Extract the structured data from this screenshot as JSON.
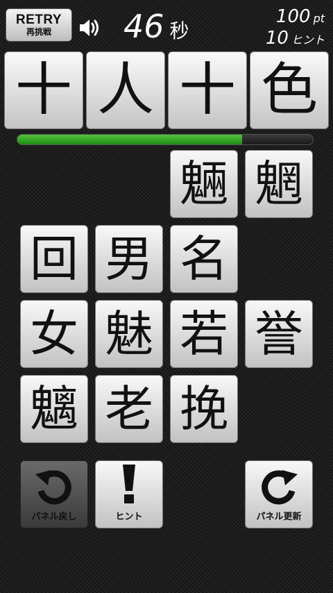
{
  "header": {
    "retry_label": "RETRY",
    "retry_sublabel": "再挑戦",
    "sound_icon": "speaker-icon",
    "timer_value": "46",
    "timer_unit": "秒",
    "points_value": "100",
    "points_unit": "pt",
    "hints_value": "10",
    "hints_unit": "ヒント"
  },
  "answer": [
    "十",
    "人",
    "十",
    "色"
  ],
  "progress": {
    "fraction": 0.76,
    "color": "#2e9f1f"
  },
  "tiles": {
    "r1c3": "魎",
    "r1c4": "魍",
    "r2c1": "回",
    "r2c2": "男",
    "r2c3": "名",
    "r3c1": "女",
    "r3c2": "魅",
    "r3c3": "若",
    "r3c4": "誉",
    "r4c1": "魑",
    "r4c2": "老",
    "r4c3": "挽"
  },
  "tools": {
    "undo_label": "パネル戻し",
    "hint_label": "ヒント",
    "refresh_label": "パネル更新"
  }
}
